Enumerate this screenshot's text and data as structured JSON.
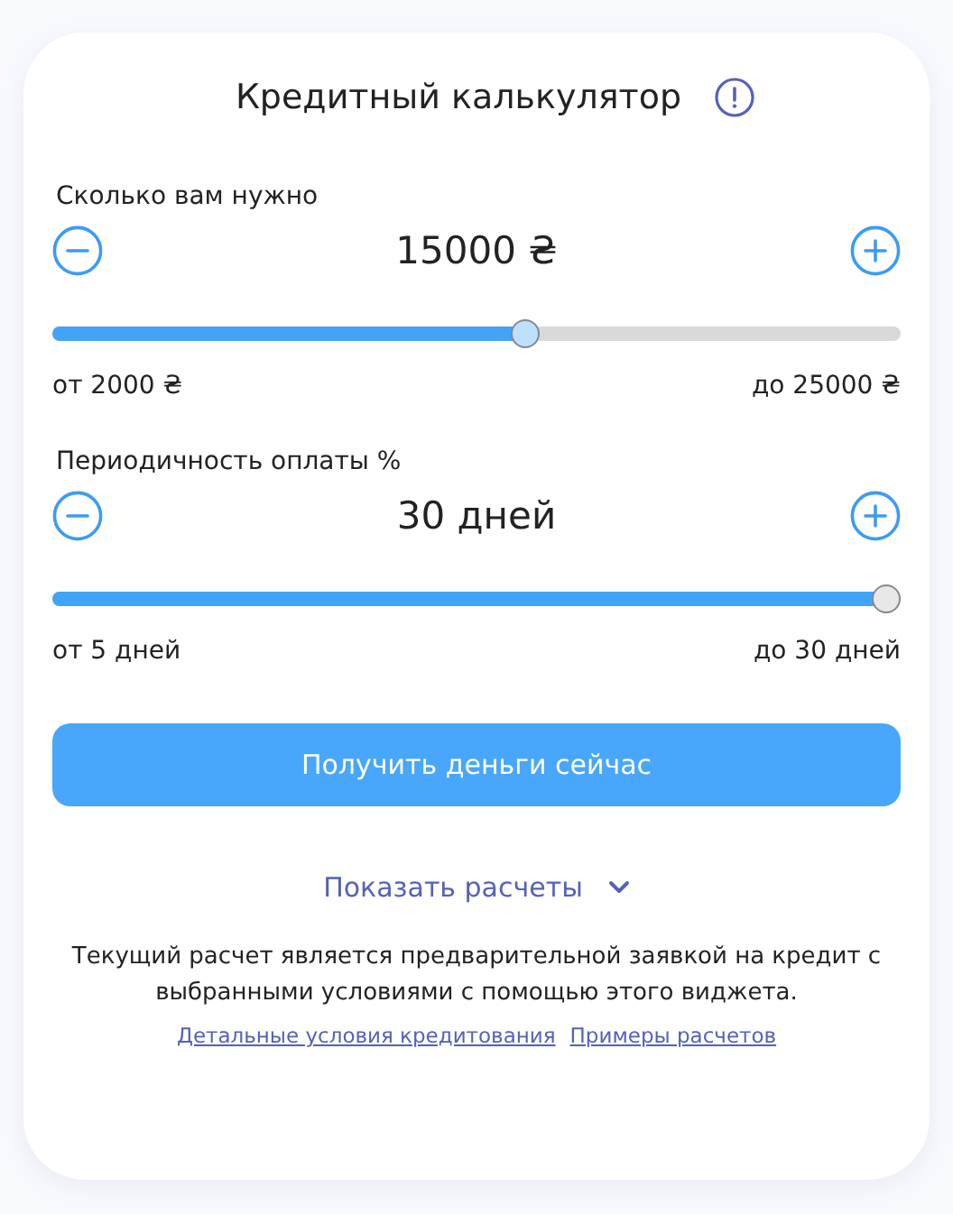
{
  "title": "Кредитный калькулятор",
  "sliders": [
    {
      "label": "Сколько вам нужно",
      "value": "15000 ₴",
      "level": 0.56,
      "min": "от 2000 ₴",
      "max": "до 25000 ₴"
    },
    {
      "label": "Периодичность оплаты %",
      "value": "30 дней",
      "level": 1,
      "min": "от 5 дней",
      "max": "до 30 дней"
    }
  ],
  "submit_button": "Получить деньги сейчас",
  "show_calculations": {
    "label": "Показать расчеты",
    "expanded": false
  },
  "disclaimer": "Текущий расчет является предварительной заявкой на кредит с выбранными условиями с помощью этого виджета.",
  "links": [
    "Детальные условия кредитования",
    "Примеры расчетов"
  ]
}
